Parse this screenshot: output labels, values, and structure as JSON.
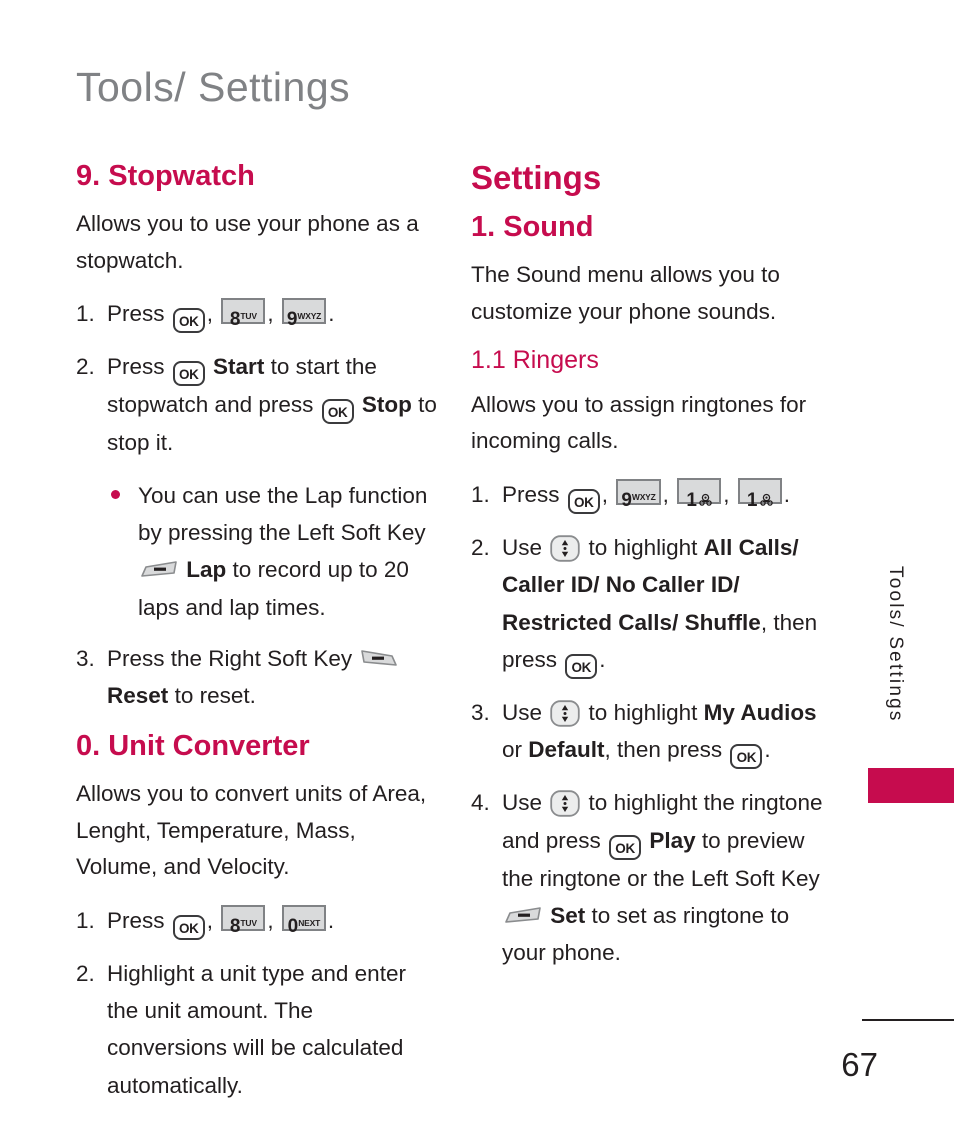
{
  "header": {
    "title": "Tools/ Settings"
  },
  "side_tab": {
    "label": "Tools/ Settings",
    "accent_color": "#c60c4e"
  },
  "footer": {
    "page_number": "67"
  },
  "colors": {
    "accent": "#c60c4e",
    "header_gray": "#808285",
    "body_text": "#231f20",
    "key_fill": "#d9dadb"
  },
  "left_column": {
    "sections": [
      {
        "heading": "9. Stopwatch",
        "intro": "Allows you to use your phone as a stopwatch.",
        "step1_num": "1.",
        "step1_press": "Press",
        "step1_comma_a": ",",
        "step1_comma_b": ",",
        "step1_period": ".",
        "step2_num": "2.",
        "step2_a": "Press",
        "step2_start": "Start",
        "step2_b": "to start the stopwatch and press",
        "step2_stop": "Stop",
        "step2_c": "to stop it.",
        "bullet_a": "You can use the Lap function by pressing the Left Soft Key",
        "bullet_lap": "Lap",
        "bullet_b": "to record up to 20 laps and lap times.",
        "step3_num": "3.",
        "step3_a": "Press the Right Soft Key",
        "step3_reset": "Reset",
        "step3_b": "to reset."
      },
      {
        "heading": "0. Unit Converter",
        "intro": "Allows you to convert units of Area, Lenght, Temperature, Mass, Volume, and Velocity.",
        "step1_num": "1.",
        "step1_press": "Press",
        "step1_comma_a": ",",
        "step1_comma_b": ",",
        "step1_period": ".",
        "step2_num": "2.",
        "step2_text": "Highlight a unit type and enter the unit amount. The conversions will be calculated automatically."
      }
    ]
  },
  "right_column": {
    "part_title": "Settings",
    "section": {
      "heading": "1. Sound",
      "intro": "The Sound menu allows you to customize your phone sounds.",
      "subheading": "1.1 Ringers",
      "sub_intro": "Allows you to assign ringtones for incoming calls.",
      "step1_num": "1.",
      "step1_press": "Press",
      "step1_comma_a": ",",
      "step1_comma_b": ",",
      "step1_comma_c": ",",
      "step1_period": ".",
      "step2_num": "2.",
      "step2_use": "Use",
      "step2_a": "to highlight",
      "step2_options": "All Calls/ Caller ID/ No Caller ID/ Restricted Calls/ Shuffle",
      "step2_b": ", then press",
      "step2_period": ".",
      "step3_num": "3.",
      "step3_use": "Use",
      "step3_a": "to highlight",
      "step3_opt1": "My Audios",
      "step3_or": "or",
      "step3_opt2": "Default",
      "step3_b": ", then press",
      "step3_period": ".",
      "step4_num": "4.",
      "step4_use": "Use",
      "step4_a": "to highlight the ringtone and press",
      "step4_play": "Play",
      "step4_b": "to preview the ringtone or the Left Soft Key",
      "step4_set": "Set",
      "step4_c": "to set as ringtone to your phone."
    }
  },
  "keys": {
    "ok": "OK",
    "k8_digit": "8",
    "k8_letters": "TUV",
    "k9_digit": "9",
    "k9_letters": "WXYZ",
    "k0_digit": "0",
    "k0_letters": "NEXT",
    "k1_digit": "1",
    "k1_letters": "voicemail",
    "nav": "up-down-navigation-key",
    "left_soft": "left-soft-key",
    "right_soft": "right-soft-key"
  }
}
